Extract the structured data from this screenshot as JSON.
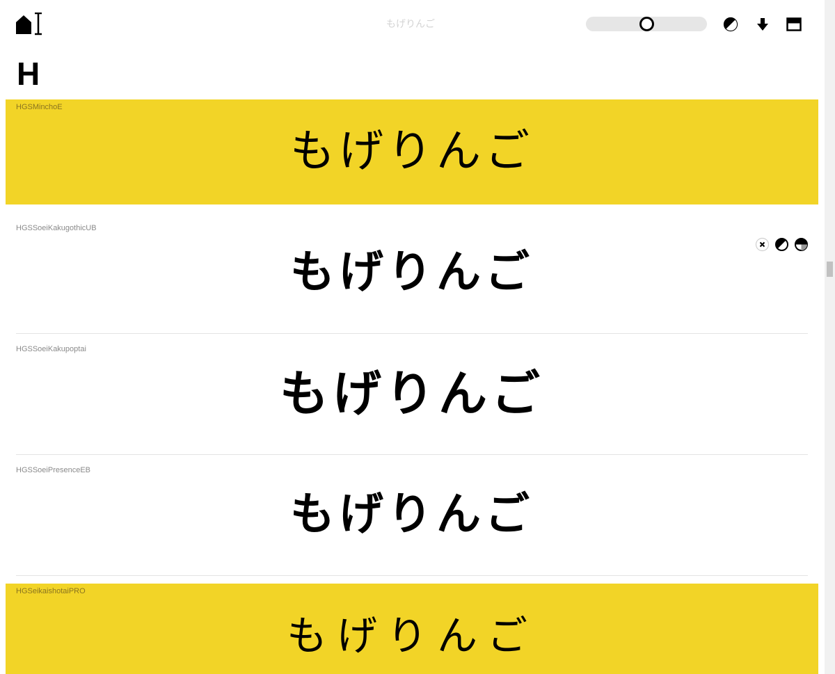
{
  "header": {
    "logo_icon": "font-logo-icon",
    "preview_text": "もげりんご",
    "slider": {
      "value": 0.5
    },
    "contrast_icon": "contrast-icon",
    "download_icon": "download-icon",
    "layout_icon": "layout-toggle-icon"
  },
  "section": {
    "letter": "H"
  },
  "colors": {
    "highlight": "#f2d427",
    "text": "#000000"
  },
  "fonts": [
    {
      "name": "HGSMinchoE",
      "sample": "もげりんご",
      "highlighted": true
    },
    {
      "name": "HGSSoeiKakugothicUB",
      "sample": "もげりんご",
      "highlighted": false,
      "show_actions": true
    },
    {
      "name": "HGSSoeiKakupoptai",
      "sample": "もげりんご",
      "highlighted": false
    },
    {
      "name": "HGSSoeiPresenceEB",
      "sample": "もげりんご",
      "highlighted": false
    },
    {
      "name": "HGSeikaishotaiPRO",
      "sample": "もげりんご",
      "highlighted": true
    }
  ],
  "row_actions": [
    "close-icon",
    "contrast-icon",
    "half-fill-icon"
  ]
}
